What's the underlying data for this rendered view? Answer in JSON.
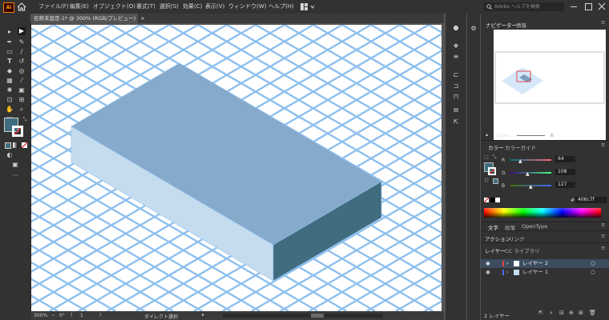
{
  "menubar": {
    "app_icon": "Ai",
    "items": [
      "ファイル(F)",
      "編集(E)",
      "オブジェクト(O)",
      "書式(T)",
      "選択(S)",
      "効果(C)",
      "表示(V)",
      "ウィンドウ(W)",
      "ヘルプ(H)"
    ],
    "search_placeholder": "Adobe ヘルプを検索"
  },
  "document": {
    "tab_title": "名称未設定-1* @ 300% (RGB/プレビュー)",
    "close_glyph": "×"
  },
  "status": {
    "zoom": "300%",
    "angle": "0°",
    "artboard": "1",
    "tool_name": "ダイレクト選択"
  },
  "navigator": {
    "tabs": [
      "ナビゲーター",
      "情報"
    ],
    "zoom": "300%"
  },
  "color_panel": {
    "tabs": [
      "カラー",
      "カラーガイド"
    ],
    "r_label": "R",
    "r_value": "64",
    "g_label": "G",
    "g_value": "108",
    "b_label": "B",
    "b_value": "127",
    "hex_symbol": "#",
    "hex": "406c7f",
    "fill_color": "#406c7f"
  },
  "type_panel": {
    "tabs": [
      "文字",
      "段落",
      "OpenType"
    ]
  },
  "action_panel": {
    "tabs": [
      "アクション",
      "リンク"
    ]
  },
  "layers_panel": {
    "tabs": [
      "レイヤー",
      "CC ライブラリ"
    ],
    "layers": [
      {
        "name": "レイヤー 2",
        "color": "#e8414a",
        "selected": true
      },
      {
        "name": "レイヤー 1",
        "color": "#4f6bff",
        "selected": false
      }
    ],
    "count_label": "2 レイヤー"
  },
  "colors": {
    "grid": "#8ec0ee",
    "box_top": "#86aacb",
    "box_left": "#c5dcef",
    "box_right": "#406c7f"
  }
}
